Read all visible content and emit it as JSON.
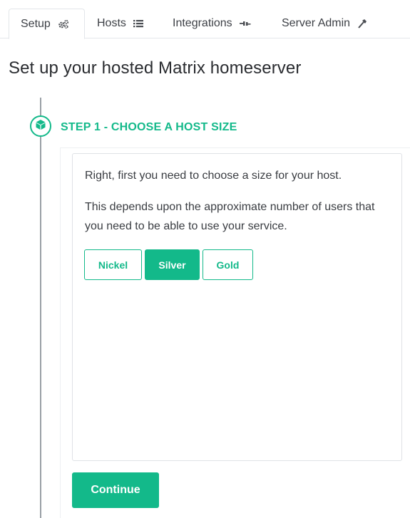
{
  "tabs": [
    {
      "label": "Setup",
      "icon": "gears-icon",
      "active": true
    },
    {
      "label": "Hosts",
      "icon": "list-icon",
      "active": false
    },
    {
      "label": "Integrations",
      "icon": "plug-icon",
      "active": false
    },
    {
      "label": "Server Admin",
      "icon": "hammer-icon",
      "active": false
    }
  ],
  "page": {
    "title": "Set up your hosted Matrix homeserver"
  },
  "step": {
    "title": "STEP 1 - CHOOSE A HOST SIZE",
    "icon": "cube-icon",
    "paragraph1": "Right, first you need to choose a size for your host.",
    "paragraph2": "This depends upon the approximate number of users that you need to be able to use your service.",
    "sizes": [
      {
        "label": "Nickel",
        "selected": false
      },
      {
        "label": "Silver",
        "selected": true
      },
      {
        "label": "Gold",
        "selected": false
      }
    ],
    "continue_label": "Continue"
  },
  "colors": {
    "accent": "#13b98a",
    "line": "#9aa0a6",
    "border": "#dfe2e6"
  }
}
